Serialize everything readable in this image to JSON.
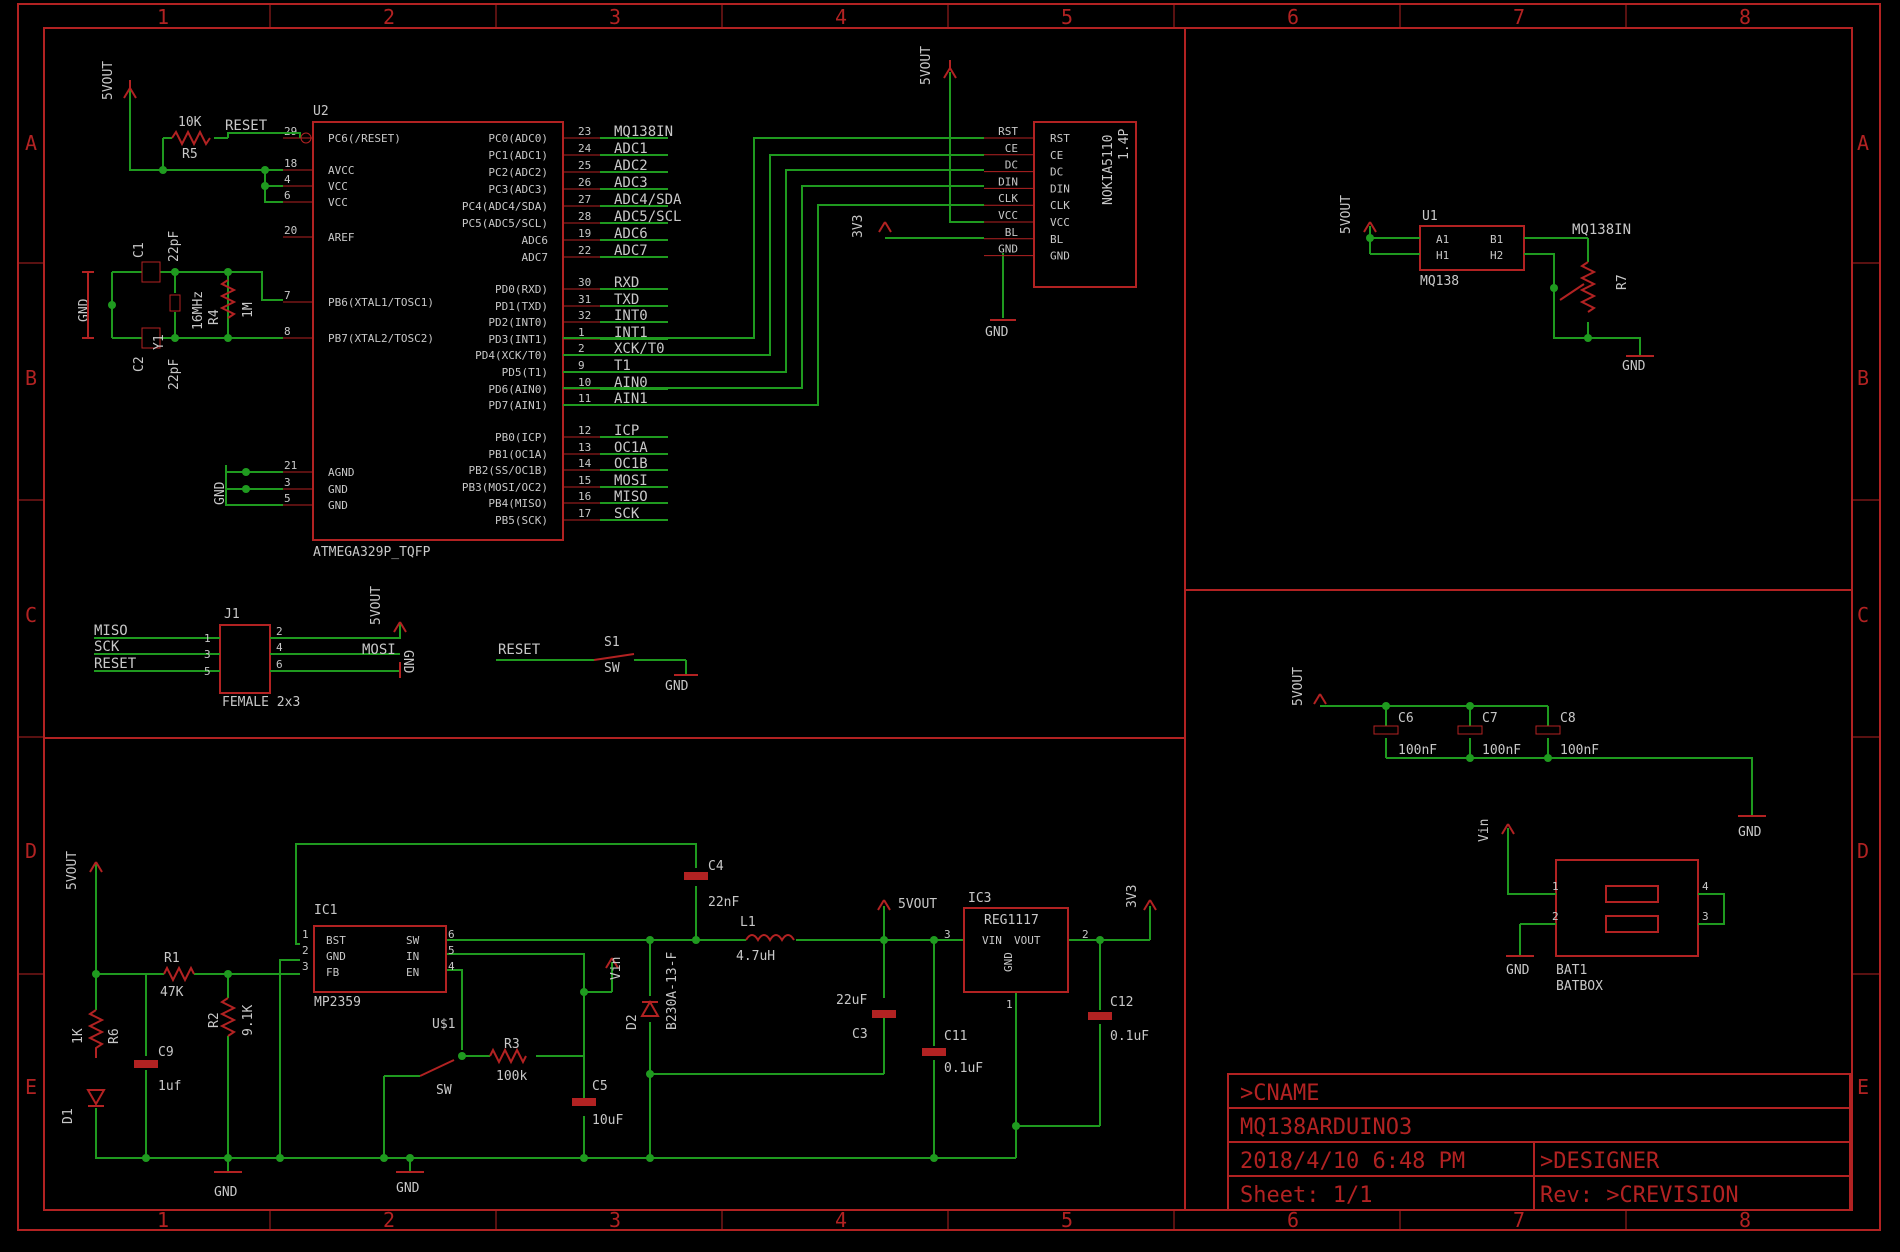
{
  "grid": {
    "columns": [
      "1",
      "2",
      "3",
      "4",
      "5",
      "6",
      "7",
      "8"
    ],
    "rows": [
      "A",
      "B",
      "C",
      "D",
      "E"
    ]
  },
  "title_block": {
    "name": ">CNAME",
    "project": "MQ138ARDUINO3",
    "date": "2018/4/10 6:48 PM",
    "designer": ">DESIGNER",
    "sheet": "Sheet: 1/1",
    "revision": "Rev: >CREVISION"
  },
  "mcu": {
    "ref": "U2",
    "value": "ATMEGA329P_TQFP",
    "left_pins": [
      {
        "num": "29",
        "name": "PC6(/RESET)"
      },
      {
        "num": "18",
        "name": "AVCC"
      },
      {
        "num": "4",
        "name": "VCC"
      },
      {
        "num": "6",
        "name": "VCC"
      },
      {
        "num": "20",
        "name": "AREF"
      },
      {
        "num": "7",
        "name": "PB6(XTAL1/TOSC1)"
      },
      {
        "num": "8",
        "name": "PB7(XTAL2/TOSC2)"
      },
      {
        "num": "21",
        "name": "AGND"
      },
      {
        "num": "3",
        "name": "GND"
      },
      {
        "num": "5",
        "name": "GND"
      }
    ],
    "right_pins": [
      {
        "num": "23",
        "name": "PC0(ADC0)",
        "net": "MQ138IN"
      },
      {
        "num": "24",
        "name": "PC1(ADC1)",
        "net": "ADC1"
      },
      {
        "num": "25",
        "name": "PC2(ADC2)",
        "net": "ADC2"
      },
      {
        "num": "26",
        "name": "PC3(ADC3)",
        "net": "ADC3"
      },
      {
        "num": "27",
        "name": "PC4(ADC4/SDA)",
        "net": "ADC4/SDA"
      },
      {
        "num": "28",
        "name": "PC5(ADC5/SCL)",
        "net": "ADC5/SCL"
      },
      {
        "num": "19",
        "name": "ADC6",
        "net": "ADC6"
      },
      {
        "num": "22",
        "name": "ADC7",
        "net": "ADC7"
      },
      {
        "num": "30",
        "name": "PD0(RXD)",
        "net": "RXD"
      },
      {
        "num": "31",
        "name": "PD1(TXD)",
        "net": "TXD"
      },
      {
        "num": "32",
        "name": "PD2(INT0)",
        "net": "INT0"
      },
      {
        "num": "1",
        "name": "PD3(INT1)",
        "net": "INT1"
      },
      {
        "num": "2",
        "name": "PD4(XCK/T0)",
        "net": "XCK/T0"
      },
      {
        "num": "9",
        "name": "PD5(T1)",
        "net": "T1"
      },
      {
        "num": "10",
        "name": "PD6(AIN0)",
        "net": "AIN0"
      },
      {
        "num": "11",
        "name": "PD7(AIN1)",
        "net": "AIN1"
      },
      {
        "num": "12",
        "name": "PB0(ICP)",
        "net": "ICP"
      },
      {
        "num": "13",
        "name": "PB1(OC1A)",
        "net": "OC1A"
      },
      {
        "num": "14",
        "name": "PB2(SS/OC1B)",
        "net": "OC1B"
      },
      {
        "num": "15",
        "name": "PB3(MOSI/OC2)",
        "net": "MOSI"
      },
      {
        "num": "16",
        "name": "PB4(MISO)",
        "net": "MISO"
      },
      {
        "num": "17",
        "name": "PB5(SCK)",
        "net": "SCK"
      }
    ]
  },
  "lcd": {
    "ref": "NOKIA5110",
    "value": "1.4P",
    "pins": [
      "RST",
      "CE",
      "DC",
      "DIN",
      "CLK",
      "VCC",
      "BL",
      "GND"
    ],
    "supply": "5VOUT",
    "bl_supply": "3V3",
    "gnd": "GND"
  },
  "mcu_misc": {
    "supply": "5VOUT",
    "reset_net": "RESET",
    "r5_value": "10K",
    "r5_ref": "R5",
    "c1_ref": "C1",
    "c1_value": "22pF",
    "c2_ref": "C2",
    "c2_value": "22pF",
    "y1_ref": "Y1",
    "y1_value": "16MHz",
    "r4_ref": "R4",
    "r4_value": "1M",
    "gnd": "GND"
  },
  "header": {
    "ref": "J1",
    "value": "FEMALE 2x3",
    "left_nets": [
      "MISO",
      "SCK",
      "RESET"
    ],
    "left_pins": [
      "1",
      "3",
      "5"
    ],
    "right_pins": [
      "2",
      "4",
      "6"
    ],
    "right_nets": [
      "MOSI"
    ],
    "supply": "5VOUT",
    "gnd": "GND"
  },
  "switch_s1": {
    "ref": "S1",
    "value": "SW",
    "net": "RESET",
    "gnd": "GND"
  },
  "sensor": {
    "ref": "U1",
    "value": "MQ138",
    "pins": [
      "A1",
      "B1",
      "H1",
      "H2"
    ],
    "net": "MQ138IN",
    "pot_ref": "R7",
    "supply": "5VOUT",
    "gnd": "GND"
  },
  "decoupling": {
    "supply": "5VOUT",
    "caps": [
      {
        "ref": "C6",
        "value": "100nF"
      },
      {
        "ref": "C7",
        "value": "100nF"
      },
      {
        "ref": "C8",
        "value": "100nF"
      }
    ],
    "gnd": "GND"
  },
  "battery": {
    "ref": "BAT1",
    "value": "BATBOX",
    "supply": "Vin",
    "pins": [
      "1",
      "2",
      "3",
      "4"
    ],
    "gnd": "GND"
  },
  "power": {
    "supply_in": "5VOUT",
    "ic1": {
      "ref": "IC1",
      "value": "MP2359",
      "pins": [
        "BST",
        "GND",
        "FB",
        "SW",
        "IN",
        "EN"
      ],
      "pin_nums": [
        "1",
        "2",
        "3",
        "6",
        "5",
        "4"
      ]
    },
    "r1": {
      "ref": "R1",
      "value": "47K"
    },
    "r2": {
      "ref": "R2",
      "value": "9.1K"
    },
    "r6": {
      "ref": "R6",
      "value": "1K"
    },
    "d1": {
      "ref": "D1"
    },
    "c9": {
      "ref": "C9",
      "value": "1uf"
    },
    "c4": {
      "ref": "C4",
      "value": "22nF"
    },
    "l1": {
      "ref": "L1",
      "value": "4.7uH"
    },
    "d2": {
      "ref": "D2",
      "value": "B230A-13-F"
    },
    "u_s1": {
      "ref": "U$1",
      "value": "SW"
    },
    "r3": {
      "ref": "R3",
      "value": "100k"
    },
    "c5": {
      "ref": "C5",
      "value": "10uF"
    },
    "vin": "Vin",
    "vout": "5VOUT",
    "c3": {
      "ref": "C3",
      "value": "22uF"
    },
    "c11": {
      "ref": "C11",
      "value": "0.1uF"
    },
    "ic3": {
      "ref": "IC3",
      "value": "REG1117",
      "pins": [
        "VIN",
        "VOUT",
        "GND"
      ],
      "pin_nums": [
        "3",
        "2",
        "1"
      ]
    },
    "c12": {
      "ref": "C12",
      "value": "0.1uF"
    },
    "out": "3V3",
    "gnd": "GND"
  }
}
